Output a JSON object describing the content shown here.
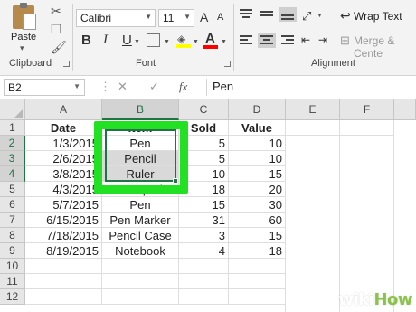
{
  "ribbon": {
    "clipboard": {
      "paste_label": "Paste",
      "group_label": "Clipboard"
    },
    "font": {
      "font_name": "Calibri",
      "font_size": "11",
      "bold": "B",
      "italic": "I",
      "underline": "U",
      "grow": "A",
      "shrink": "A",
      "font_color": "A",
      "group_label": "Font",
      "highlight_color": "#ffff00",
      "font_color_value": "#ff0000"
    },
    "alignment": {
      "wrap_text": "Wrap Text",
      "merge_center": "Merge & Cente",
      "group_label": "Alignment"
    }
  },
  "formula_bar": {
    "name_box": "B2",
    "fx": "fx",
    "cancel": "✕",
    "enter": "✓",
    "content": "Pen"
  },
  "columns": [
    "A",
    "B",
    "C",
    "D",
    "E",
    "F"
  ],
  "rows": [
    "1",
    "2",
    "3",
    "4",
    "5",
    "6",
    "7",
    "8",
    "9",
    "10",
    "11",
    "12"
  ],
  "cells": {
    "headers": {
      "a": "Date",
      "b": "Item",
      "c": "Sold",
      "d": "Value"
    },
    "data": [
      {
        "a": "1/3/2015",
        "b": "Pen",
        "c": "5",
        "d": "10"
      },
      {
        "a": "2/6/2015",
        "b": "Pencil",
        "c": "5",
        "d": "10"
      },
      {
        "a": "3/8/2015",
        "b": "Ruler",
        "c": "10",
        "d": "15"
      },
      {
        "a": "4/3/2015",
        "b": "Notepad",
        "c": "18",
        "d": "20"
      },
      {
        "a": "5/7/2015",
        "b": "Pen",
        "c": "15",
        "d": "30"
      },
      {
        "a": "6/15/2015",
        "b": "Pen Marker",
        "c": "31",
        "d": "60"
      },
      {
        "a": "7/18/2015",
        "b": "Pencil Case",
        "c": "3",
        "d": "15"
      },
      {
        "a": "8/19/2015",
        "b": "Notebook",
        "c": "4",
        "d": "18"
      }
    ]
  },
  "selection": {
    "range": "B2:B4",
    "active_cell": "B2",
    "accent": "#217346",
    "highlight": "#22e022"
  },
  "watermark": {
    "wiki": "wiki",
    "how": "How"
  }
}
